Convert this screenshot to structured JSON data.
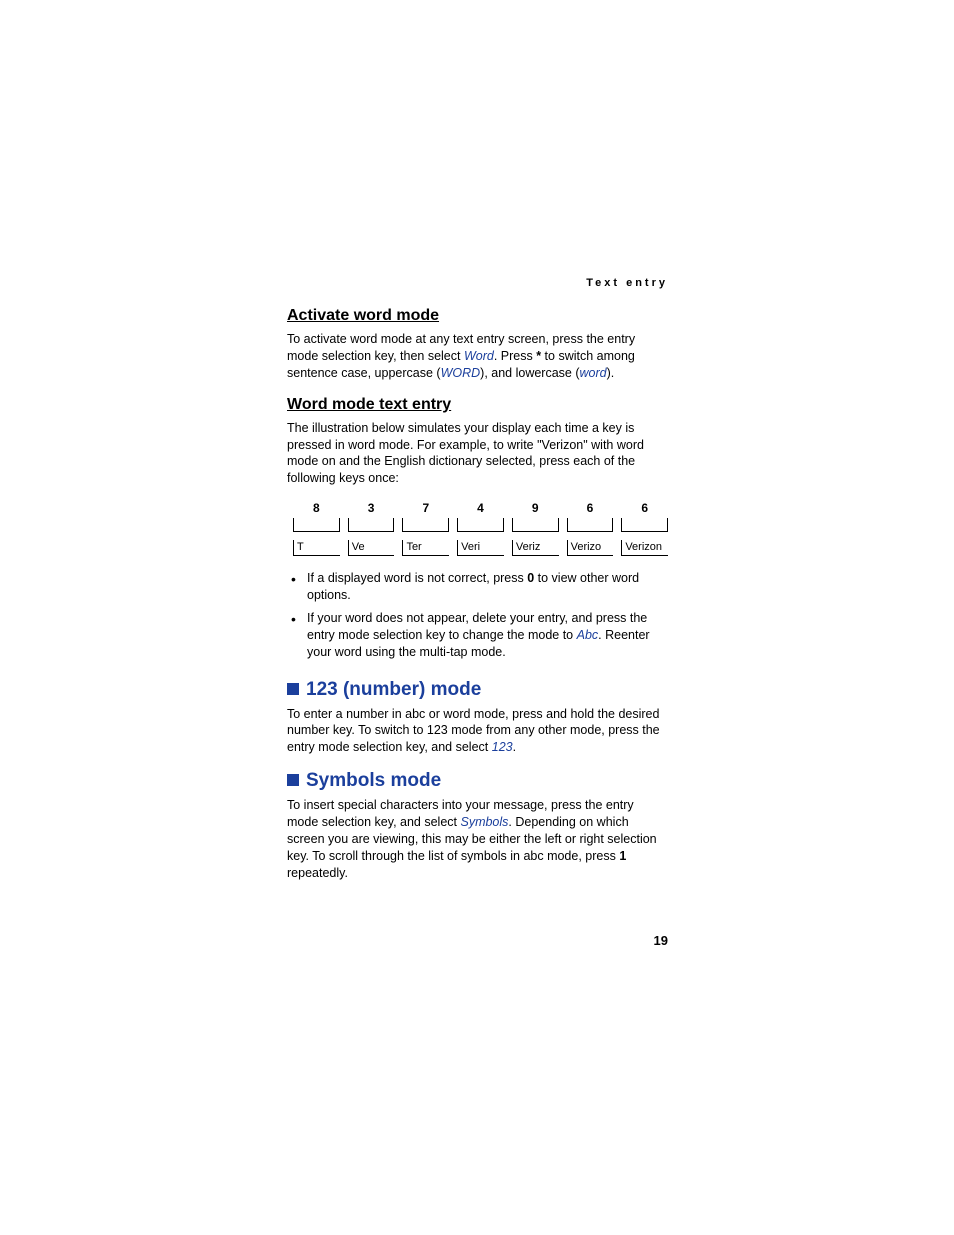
{
  "running_head": "Text entry",
  "section1": {
    "title": "Activate word mode",
    "p1_a": "To activate word mode at any text entry screen, press the entry mode selection key, then select ",
    "link1": "Word",
    "p1_b": ". Press ",
    "bold1": "*",
    "p1_c": " to switch among sentence case, uppercase (",
    "link2": "WORD",
    "p1_d": "), and lowercase (",
    "link3": "word",
    "p1_e": ")."
  },
  "section2": {
    "title": "Word mode text entry",
    "p1": "The illustration below simulates your display each time a key is pressed in word mode. For example, to write \"Verizon\" with word mode on and the English dictionary selected, press each of the following keys once:",
    "keys": [
      "8",
      "3",
      "7",
      "4",
      "9",
      "6",
      "6"
    ],
    "results": [
      "T",
      "Ve",
      "Ter",
      "Veri",
      "Veriz",
      "Verizo",
      "Verizon"
    ],
    "bullet1_a": "If a displayed word is not correct, press ",
    "bullet1_bold": "0",
    "bullet1_b": " to view other word options.",
    "bullet2_a": "If your word does not appear, delete your entry, and press the entry mode selection key to change the mode to ",
    "bullet2_link": "Abc",
    "bullet2_b": ". Reenter your word using the multi-tap mode."
  },
  "section3": {
    "title": "123 (number) mode",
    "p1_a": "To enter a number in abc or word mode, press and hold the desired number key. To switch to 123 mode from any other mode, press the entry mode selection key, and select ",
    "link1": "123",
    "p1_b": "."
  },
  "section4": {
    "title": "Symbols mode",
    "p1_a": "To insert special characters into your message, press the entry mode selection key, and select ",
    "link1": "Symbols",
    "p1_b": ". Depending on which screen you are viewing, this may be either the left or right selection key. To scroll through the list of symbols in abc mode, press ",
    "bold1": "1",
    "p1_c": " repeatedly."
  },
  "page_number": "19"
}
